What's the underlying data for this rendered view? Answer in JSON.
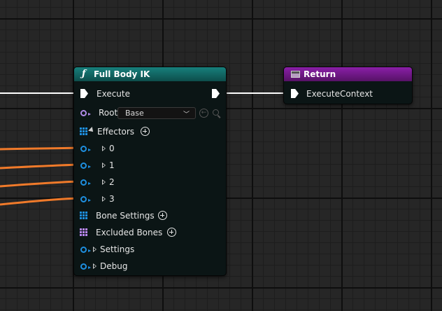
{
  "full_body_ik": {
    "title": "Full Body IK",
    "execute_label": "Execute",
    "root_label": "Root",
    "root_value": "Base",
    "effectors_label": "Effectors",
    "effectors": [
      "0",
      "1",
      "2",
      "3"
    ],
    "bone_settings_label": "Bone Settings",
    "excluded_bones_label": "Excluded Bones",
    "settings_label": "Settings",
    "debug_label": "Debug"
  },
  "return_node": {
    "title": "Return",
    "execute_context_label": "ExecuteContext"
  },
  "colors": {
    "ik_header": "#17807c",
    "return_header": "#8a1fa8",
    "struct_pin": "#1e8fe0",
    "rig_element_pin": "#b18ae8",
    "wire_orange": "#f07a2a",
    "exec_wire": "#ffffff"
  },
  "icons": [
    "function-icon",
    "return-icon",
    "exec-pin-icon",
    "struct-pin-icon",
    "array-pin-icon",
    "add-icon",
    "expand-arrow-icon",
    "collapse-arrow-icon",
    "dropdown-chevron-icon",
    "use-selected-icon",
    "browse-icon"
  ]
}
